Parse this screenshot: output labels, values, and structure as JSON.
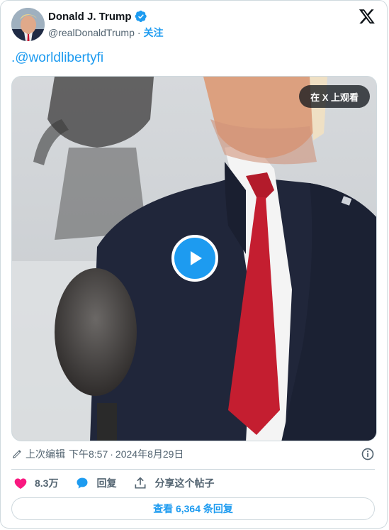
{
  "author": {
    "display_name": "Donald J. Trump",
    "handle": "@realDonaldTrump",
    "separator": "·",
    "follow_label": "关注",
    "verified_color": "#1d9bf0"
  },
  "tweet": {
    "text": ".@worldlibertyfi"
  },
  "media": {
    "watch_on_x_label": "在 X 上观看",
    "play_icon": "play-icon"
  },
  "meta": {
    "edited_label": "上次编辑",
    "time": "下午8:57",
    "separator": "·",
    "date": "2024年8月29日"
  },
  "actions": {
    "likes_count": "8.3万",
    "reply_label": "回复",
    "share_label": "分享这个帖子",
    "like_color": "#f91880"
  },
  "footer": {
    "view_replies_label": "查看 6,364 条回复"
  },
  "colors": {
    "accent": "#1d9bf0",
    "text_secondary": "#536471",
    "border": "#cfd9de"
  }
}
